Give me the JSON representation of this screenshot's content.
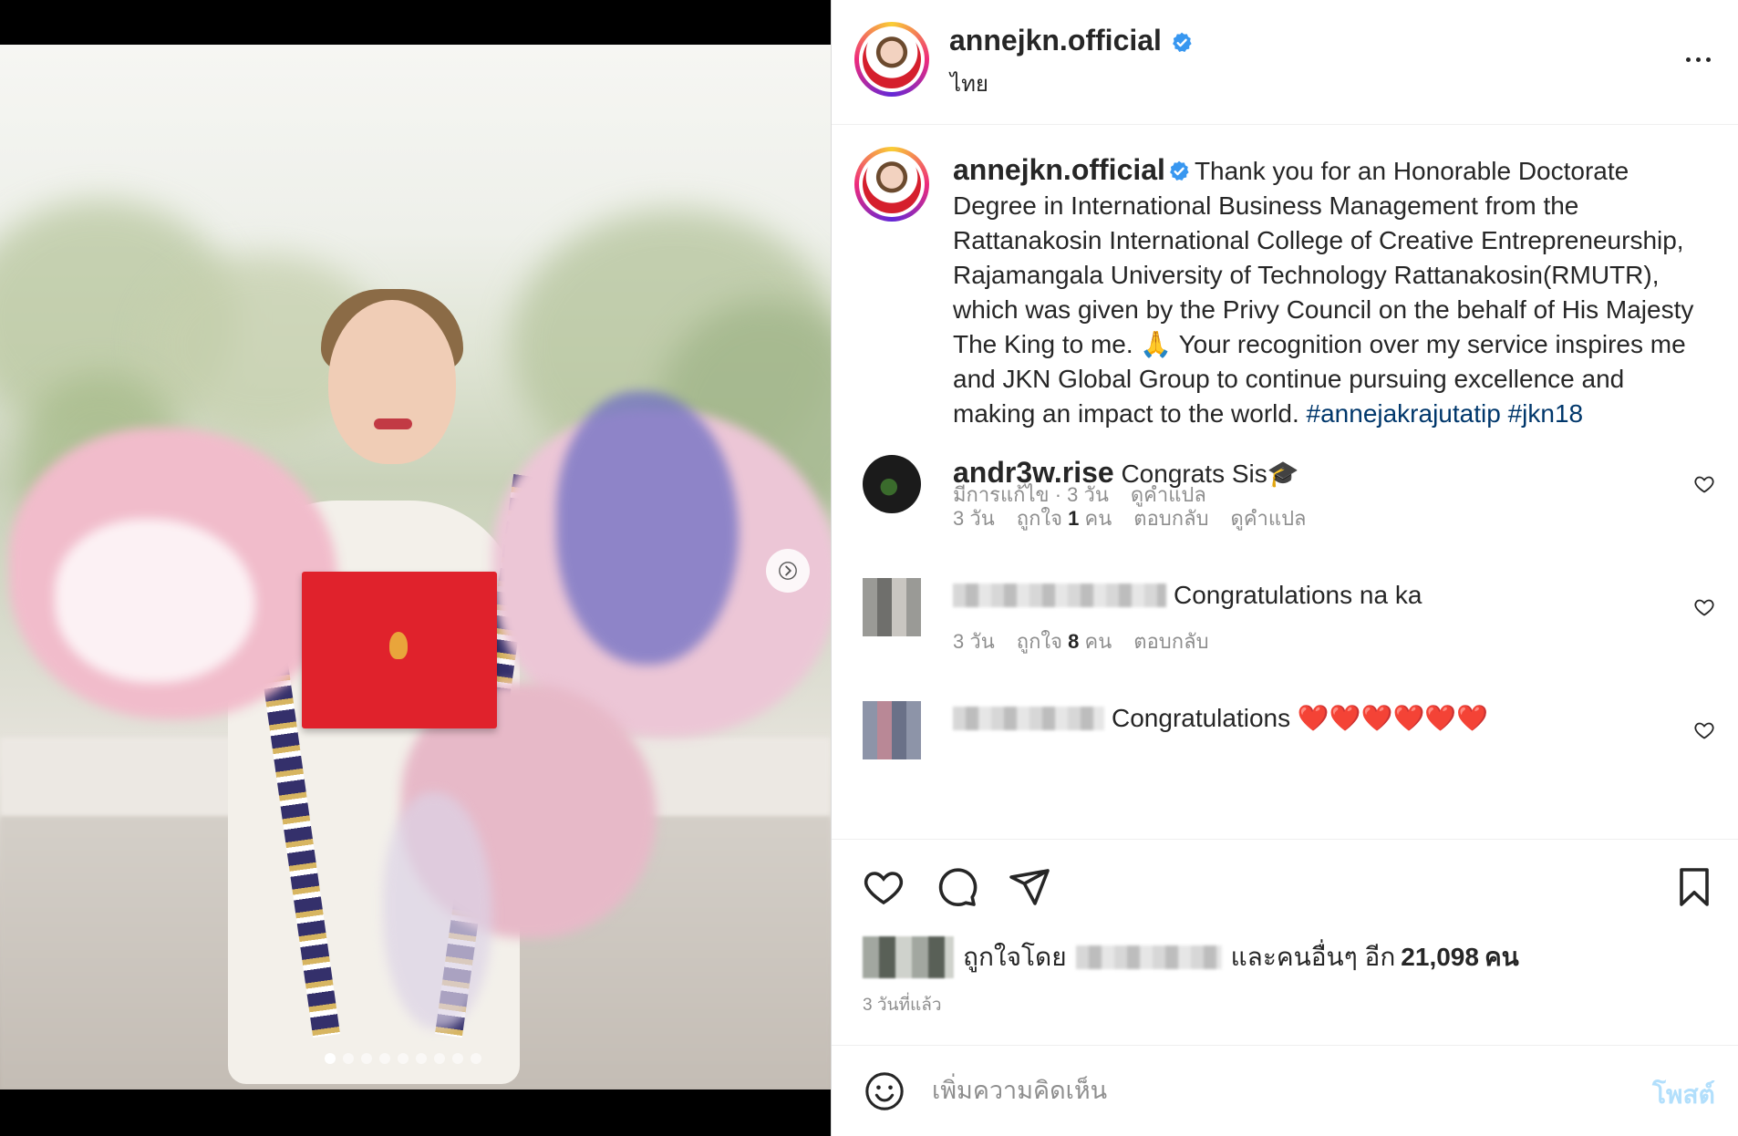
{
  "post": {
    "username": "annejkn.official",
    "location": "ไทย",
    "caption_text": "Thank you for an Honorable Doctorate Degree in International Business Management from the Rattanakosin International College of Creative Entrepreneurship, Rajamangala University of Technology Rattanakosin(RMUTR), which was given by the Privy Council on the behalf of His Majesty The King to me. 🙏 Your recognition over my service inspires me and JKN Global Group to continue pursuing excellence and making an impact to the world.",
    "hashtags": [
      "#annejakrajutatip",
      "#jkn18"
    ],
    "caption_meta": {
      "edited": "มีการแก้ไข · 3 วัน",
      "translate": "ดูคำแปล"
    }
  },
  "comments": [
    {
      "username": "andr3w.rise",
      "text": "Congrats Sis🎓",
      "time": "3 วัน",
      "likes_prefix": "ถูกใจ",
      "likes_count": "1",
      "likes_suffix": "คน",
      "reply": "ตอบกลับ",
      "translate": "ดูคำแปล"
    },
    {
      "username": "",
      "text": "Congratulations na ka",
      "time": "3 วัน",
      "likes_prefix": "ถูกใจ",
      "likes_count": "8",
      "likes_suffix": "คน",
      "reply": "ตอบกลับ"
    },
    {
      "username": "",
      "text": "Congratulations ❤️❤️❤️❤️❤️❤️"
    }
  ],
  "likes": {
    "prefix": "ถูกใจโดย",
    "middle": "และคนอื่นๆ อีก",
    "count": "21,098",
    "suffix": "คน"
  },
  "post_time": "3 วันที่แล้ว",
  "composer": {
    "placeholder": "เพิ่มความคิดเห็น",
    "post_label": "โพสต์"
  },
  "carousel": {
    "total": 9,
    "active": 0
  },
  "colors": {
    "verified": "#3897f0",
    "hashtag": "#00376b",
    "post_button": "#b2dffc",
    "diploma": "#e0222c"
  },
  "icons": [
    "verified-badge-icon",
    "more-options-icon",
    "heart-icon",
    "comment-icon",
    "share-icon",
    "bookmark-icon",
    "emoji-icon",
    "chevron-right-icon"
  ]
}
